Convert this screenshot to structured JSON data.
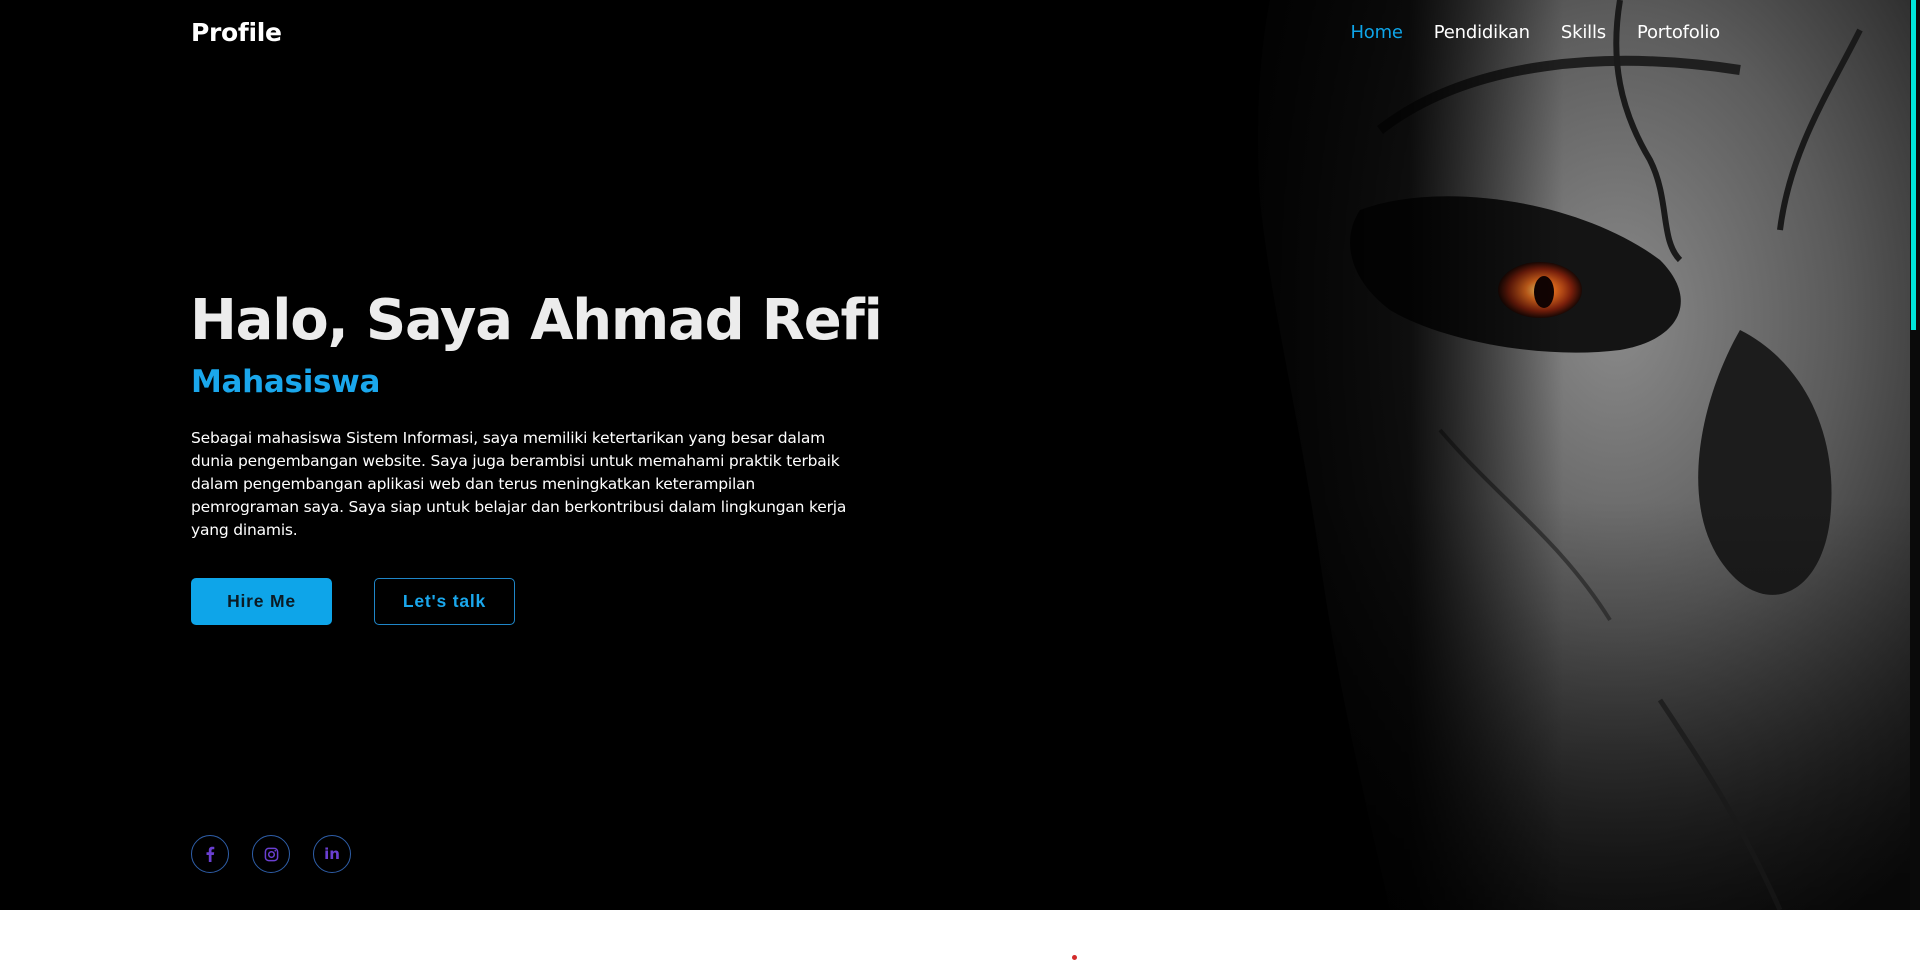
{
  "brand": "Profile",
  "nav": {
    "items": [
      "Home",
      "Pendidikan",
      "Skills",
      "Portofolio"
    ],
    "active": "Home"
  },
  "hero": {
    "title": "Halo, Saya Ahmad Refi",
    "subtitle": "Mahasiswa",
    "description": "Sebagai mahasiswa Sistem Informasi, saya memiliki ketertarikan yang besar dalam dunia pengembangan website. Saya juga berambisi untuk memahami praktik terbaik dalam pengembangan aplikasi web dan terus meningkatkan keterampilan pemrograman saya. Saya siap untuk belajar dan berkontribusi dalam lingkungan kerja yang dinamis.",
    "buttons": {
      "hire": "Hire Me",
      "talk": "Let's talk"
    }
  },
  "socials": [
    {
      "icon": "facebook-icon"
    },
    {
      "icon": "instagram-icon"
    },
    {
      "icon": "linkedin-icon",
      "glyph": "in"
    }
  ],
  "colors": {
    "accent": "#0ea5e9",
    "background": "#000000",
    "scroll_thumb": "#00e3d9"
  }
}
